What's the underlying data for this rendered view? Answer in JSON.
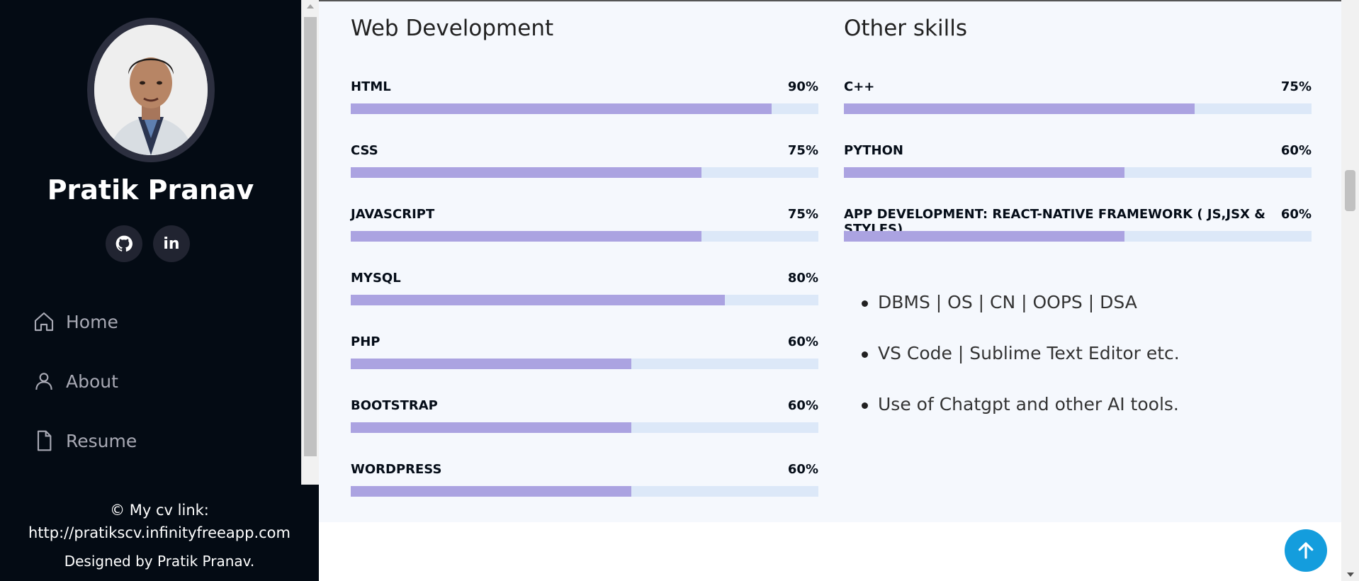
{
  "sidebar": {
    "name": "Pratik Pranav",
    "social": [
      {
        "icon": "github-icon"
      },
      {
        "icon": "linkedin-icon",
        "text": "in"
      }
    ],
    "nav": [
      {
        "label": "Home",
        "icon": "home-icon"
      },
      {
        "label": "About",
        "icon": "person-icon"
      },
      {
        "label": "Resume",
        "icon": "file-icon"
      }
    ],
    "footer": {
      "line1": "© My cv link:",
      "line2": "http://pratikscv.infinityfreeapp.com",
      "line3": "Designed by Pratik Pranav."
    }
  },
  "skills": {
    "web": {
      "title": "Web Development",
      "items": [
        {
          "label": "HTML",
          "percent_text": "90%",
          "value": 90
        },
        {
          "label": "CSS",
          "percent_text": "75%",
          "value": 75
        },
        {
          "label": "JAVASCRIPT",
          "percent_text": "75%",
          "value": 75
        },
        {
          "label": "MYSQL",
          "percent_text": "80%",
          "value": 80
        },
        {
          "label": "PHP",
          "percent_text": "60%",
          "value": 60
        },
        {
          "label": "BOOTSTRAP",
          "percent_text": "60%",
          "value": 60
        },
        {
          "label": "WORDPRESS",
          "percent_text": "60%",
          "value": 60
        }
      ]
    },
    "other": {
      "title": "Other skills",
      "items": [
        {
          "label": "C++",
          "percent_text": "75%",
          "value": 75
        },
        {
          "label": "PYTHON",
          "percent_text": "60%",
          "value": 60
        },
        {
          "label": "APP DEVELOPMENT: REACT-NATIVE FRAMEWORK ( JS,JSX & STYLES)",
          "percent_text": "60%",
          "value": 60
        }
      ],
      "bullets": [
        "DBMS | OS | CN | OOPS | DSA",
        "VS Code | Sublime Text Editor etc.",
        "Use of Chatgpt and other AI tools."
      ]
    }
  },
  "colors": {
    "sidebar_bg": "#040b14",
    "section_bg": "#f5f8fd",
    "bar_fill": "#aba3e1",
    "bar_track": "#dce8f8",
    "accent": "#149ddd"
  }
}
